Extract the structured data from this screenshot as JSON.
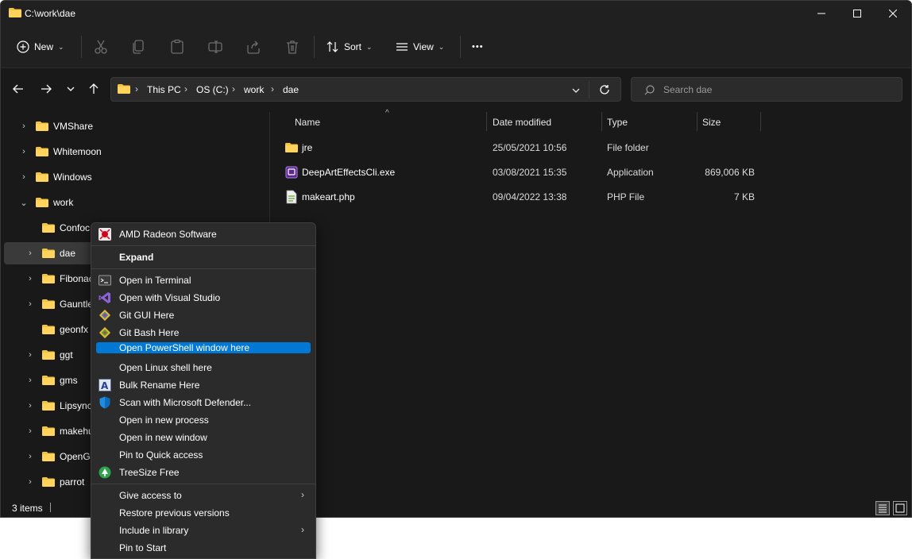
{
  "window": {
    "title": "C:\\work\\dae"
  },
  "toolbar": {
    "new_label": "New",
    "sort_label": "Sort",
    "view_label": "View",
    "more_label": "•••"
  },
  "address": {
    "crumbs": [
      "This PC",
      "OS (C:)",
      "work",
      "dae"
    ]
  },
  "search": {
    "placeholder": "Search dae"
  },
  "nav_tree": [
    {
      "label": "VMShare",
      "level": 0,
      "expandable": true,
      "expanded": false
    },
    {
      "label": "Whitemoon",
      "level": 0,
      "expandable": true,
      "expanded": false
    },
    {
      "label": "Windows",
      "level": 0,
      "expandable": true,
      "expanded": false
    },
    {
      "label": "work",
      "level": 0,
      "expandable": true,
      "expanded": true
    },
    {
      "label": "Confoc",
      "level": 1,
      "expandable": false
    },
    {
      "label": "dae",
      "level": 1,
      "expandable": true,
      "selected": true
    },
    {
      "label": "Fibonac",
      "level": 1,
      "expandable": true
    },
    {
      "label": "Gauntle",
      "level": 1,
      "expandable": true
    },
    {
      "label": "geonfx",
      "level": 1,
      "expandable": false
    },
    {
      "label": "ggt",
      "level": 1,
      "expandable": true
    },
    {
      "label": "gms",
      "level": 1,
      "expandable": true
    },
    {
      "label": "Lipsync",
      "level": 1,
      "expandable": true
    },
    {
      "label": "makehu",
      "level": 1,
      "expandable": true
    },
    {
      "label": "OpenG",
      "level": 1,
      "expandable": true
    },
    {
      "label": "parrot",
      "level": 1,
      "expandable": true
    }
  ],
  "columns": {
    "name": "Name",
    "date": "Date modified",
    "type": "Type",
    "size": "Size"
  },
  "files": [
    {
      "name": "jre",
      "date": "25/05/2021 10:56",
      "type": "File folder",
      "size": "",
      "icon": "folder-icon"
    },
    {
      "name": "DeepArtEffectsCli.exe",
      "date": "03/08/2021 15:35",
      "type": "Application",
      "size": "869,006 KB",
      "icon": "exe-icon"
    },
    {
      "name": "makeart.php",
      "date": "09/04/2022 13:38",
      "type": "PHP File",
      "size": "7 KB",
      "icon": "php-file-icon"
    }
  ],
  "status": {
    "items_label": "3 items"
  },
  "context_menu": {
    "items": [
      {
        "label": "AMD Radeon Software",
        "icon": "amd-radeon-icon"
      },
      {
        "label": "Expand",
        "bold": true
      },
      {
        "label": "Open in Terminal",
        "icon": "terminal-icon"
      },
      {
        "label": "Open with Visual Studio",
        "icon": "visual-studio-icon"
      },
      {
        "label": "Git GUI Here",
        "icon": "git-gui-icon"
      },
      {
        "label": "Git Bash Here",
        "icon": "git-bash-icon"
      },
      {
        "label": "Open PowerShell window here",
        "highlighted": true
      },
      {
        "label": "Open Linux shell here"
      },
      {
        "label": "Bulk Rename Here",
        "icon": "bulk-rename-icon"
      },
      {
        "label": "Scan with Microsoft Defender...",
        "icon": "defender-shield-icon"
      },
      {
        "label": "Open in new process"
      },
      {
        "label": "Open in new window"
      },
      {
        "label": "Pin to Quick access"
      },
      {
        "label": "TreeSize Free",
        "icon": "treesize-icon"
      },
      {
        "label": "Give access to",
        "submenu": true
      },
      {
        "label": "Restore previous versions"
      },
      {
        "label": "Include in library",
        "submenu": true
      },
      {
        "label": "Pin to Start"
      }
    ]
  },
  "colors": {
    "window_bg": "#191919",
    "toolbar_bg": "#202020",
    "menu_bg": "#2b2b2b",
    "highlight": "#0078d4",
    "folder": "#f5c242"
  }
}
